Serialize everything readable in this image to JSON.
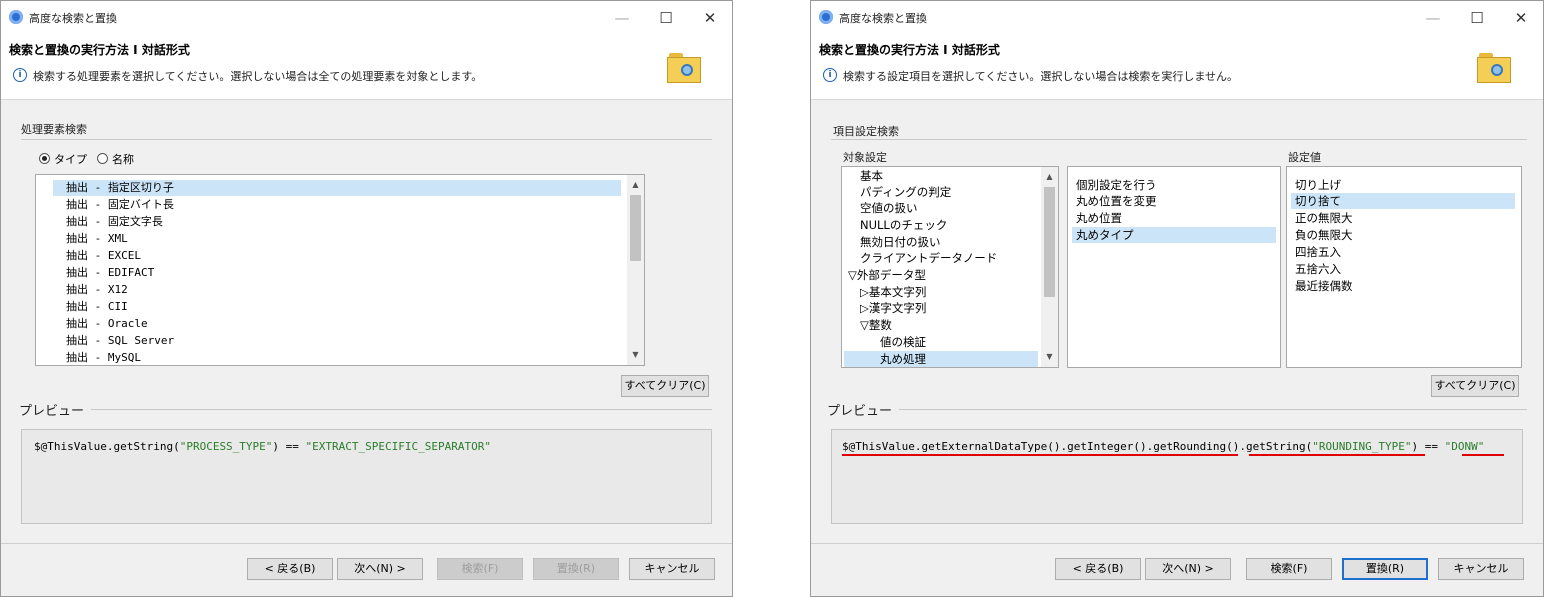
{
  "left": {
    "window_title": "高度な検索と置換",
    "header_title": "検索と置換の実行方法 I 対話形式",
    "header_message": "検索する処理要素を選択してください。選択しない場合は全ての処理要素を対象とします。",
    "group_label": "処理要素検索",
    "radio_type": "タイプ",
    "radio_name": "名称",
    "items": [
      "抽出 - 指定区切り子",
      "抽出 - 固定バイト長",
      "抽出 - 固定文字長",
      "抽出 - XML",
      "抽出 - EXCEL",
      "抽出 - EDIFACT",
      "抽出 - X12",
      "抽出 - CII",
      "抽出 - Oracle",
      "抽出 - SQL Server",
      "抽出 - MySQL"
    ],
    "clear_all": "すべてクリア(C)",
    "preview_label": "プレビュー",
    "code_prefix": "$@ThisValue.getString(",
    "code_arg": "\"PROCESS_TYPE\"",
    "code_op": ") == ",
    "code_value": "\"EXTRACT_SPECIFIC_SEPARATOR\"",
    "back": "< 戻る(B)",
    "next": "次へ(N) >",
    "search": "検索(F)",
    "replace": "置換(R)",
    "cancel": "キャンセル"
  },
  "right": {
    "window_title": "高度な検索と置換",
    "header_title": "検索と置換の実行方法 I 対話形式",
    "header_message": "検索する設定項目を選択してください。選択しない場合は検索を実行しません。",
    "group_label": "項目設定検索",
    "target_label": "対象設定",
    "value_label": "設定値",
    "tree_items": [
      "基本",
      "パディングの判定",
      "空値の扱い",
      "NULLのチェック",
      "無効日付の扱い",
      "クライアントデータノード",
      "▽外部データ型",
      "▷基本文字列",
      "▷漢字文字列",
      "▽整数",
      "値の検証",
      "丸め処理"
    ],
    "options": [
      "個別設定を行う",
      "丸め位置を変更",
      "丸め位置",
      "丸めタイプ"
    ],
    "values": [
      "切り上げ",
      "切り捨て",
      "正の無限大",
      "負の無限大",
      "四捨五入",
      "五捨六入",
      "最近接偶数"
    ],
    "clear_all": "すべてクリア(C)",
    "preview_label": "プレビュー",
    "code_prefix": "$@ThisValue.getExternalDataType().getInteger().getRounding().getString(",
    "code_arg": "\"ROUNDING_TYPE\"",
    "code_op": ") == ",
    "code_value": "\"DONW\"",
    "back": "< 戻る(B)",
    "next": "次へ(N) >",
    "search": "検索(F)",
    "replace": "置換(R)",
    "cancel": "キャンセル"
  },
  "window_controls": {
    "minimize": "—",
    "maximize": "☐",
    "close": "✕"
  }
}
